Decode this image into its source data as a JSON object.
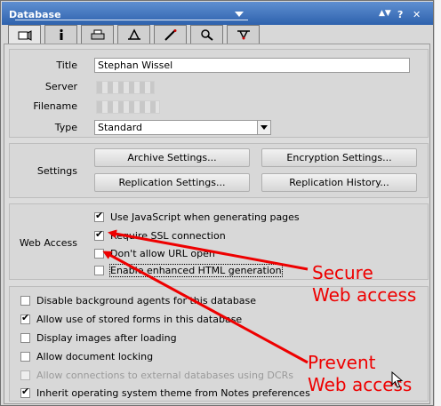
{
  "window": {
    "title": "Database",
    "controls": [
      "▲▼",
      "?",
      "✕"
    ]
  },
  "tabs": [
    {
      "icon": "basics-icon",
      "active": true
    },
    {
      "icon": "info-icon",
      "active": false
    },
    {
      "icon": "printer-icon",
      "active": false
    },
    {
      "icon": "design-icon",
      "active": false
    },
    {
      "icon": "launch-icon",
      "active": false
    },
    {
      "icon": "search-icon",
      "active": false
    },
    {
      "icon": "advanced-icon",
      "active": false
    }
  ],
  "info": {
    "title_label": "Title",
    "title_value": "Stephan Wissel",
    "server_label": "Server",
    "filename_label": "Filename",
    "type_label": "Type",
    "type_value": "Standard"
  },
  "settings": {
    "label": "Settings",
    "archive": "Archive Settings...",
    "encryption": "Encryption Settings...",
    "replication": "Replication Settings...",
    "replication_history": "Replication History..."
  },
  "web_access": {
    "label": "Web Access",
    "options": [
      {
        "label": "Use JavaScript when generating pages",
        "checked": true
      },
      {
        "label": "Require SSL connection",
        "checked": true
      },
      {
        "label": "Don't allow URL open",
        "checked": false
      },
      {
        "label": "Enable enhanced HTML generation",
        "checked": false
      }
    ]
  },
  "general": {
    "options": [
      {
        "label": "Disable background agents for this database",
        "checked": false,
        "disabled": false
      },
      {
        "label": "Allow use of stored forms in this database",
        "checked": true,
        "disabled": false
      },
      {
        "label": "Display images after loading",
        "checked": false,
        "disabled": false
      },
      {
        "label": "Allow document locking",
        "checked": false,
        "disabled": false
      },
      {
        "label": "Allow connections to external databases using DCRs",
        "checked": false,
        "disabled": true
      },
      {
        "label": "Inherit operating system theme from Notes preferences",
        "checked": true,
        "disabled": false
      }
    ]
  },
  "annotations": {
    "secure_line1": "Secure",
    "secure_line2": "Web access",
    "prevent_line1": "Prevent",
    "prevent_line2": "Web access",
    "color": "#ee0000"
  }
}
